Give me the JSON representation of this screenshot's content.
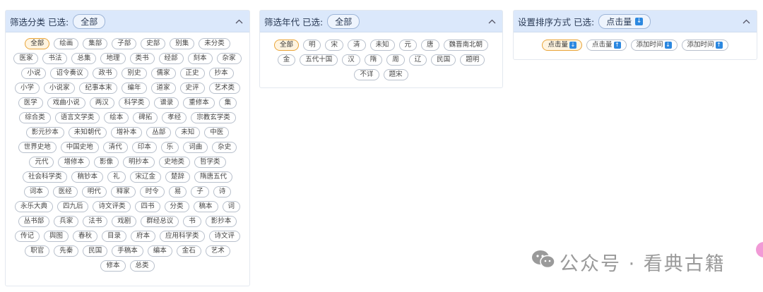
{
  "category_panel": {
    "title": "筛选分类 已选:",
    "selected": "全部",
    "tags": [
      "全部",
      "绘画",
      "集部",
      "子部",
      "史部",
      "别集",
      "未分类",
      "医家",
      "书法",
      "总集",
      "地理",
      "类书",
      "经部",
      "刻本",
      "杂家",
      "小说",
      "诏令奏议",
      "政书",
      "别史",
      "儒家",
      "正史",
      "抄本",
      "小学",
      "小说家",
      "纪事本末",
      "编年",
      "道家",
      "史评",
      "艺术类",
      "医学",
      "戏曲小说",
      "两汉",
      "科学类",
      "谱录",
      "重修本",
      "集",
      "综合类",
      "语言文学类",
      "绘本",
      "碑拓",
      "孝经",
      "宗教玄学类",
      "影元抄本",
      "未知朝代",
      "增补本",
      "丛部",
      "未知",
      "中医",
      "世界史地",
      "中国史地",
      "清代",
      "印本",
      "乐",
      "词曲",
      "杂史",
      "元代",
      "增修本",
      "影像",
      "明抄本",
      "史地类",
      "哲学类",
      "社会科学类",
      "稿钞本",
      "礼",
      "宋辽金",
      "楚辞",
      "隋唐五代",
      "词本",
      "医经",
      "明代",
      "释家",
      "时令",
      "易",
      "子",
      "诗",
      "永乐大典",
      "四九后",
      "诗文评类",
      "四书",
      "分类",
      "稿本",
      "词",
      "丛书部",
      "兵家",
      "法书",
      "戏剧",
      "群经总议",
      "书",
      "影抄本",
      "传记",
      "舆图",
      "春秋",
      "目录",
      "府本",
      "应用科学类",
      "诗文评",
      "职官",
      "先秦",
      "民国",
      "手稿本",
      "编本",
      "金石",
      "艺术",
      "修本",
      "总类"
    ]
  },
  "era_panel": {
    "title": "筛选年代 已选:",
    "selected": "全部",
    "tags": [
      "全部",
      "明",
      "宋",
      "清",
      "未知",
      "元",
      "唐",
      "魏晋南北朝",
      "金",
      "五代十国",
      "汉",
      "隋",
      "周",
      "辽",
      "民国",
      "题明",
      "不详",
      "题宋"
    ]
  },
  "sort_panel": {
    "title": "设置排序方式 已选:",
    "selected": "点击量",
    "selected_arrow": "↓",
    "options": [
      {
        "label": "点击量",
        "arrow": "↓"
      },
      {
        "label": "点击量",
        "arrow": "↑"
      },
      {
        "label": "添加时间",
        "arrow": "↓"
      },
      {
        "label": "添加时间",
        "arrow": "↑"
      }
    ]
  },
  "watermark": {
    "text": "公众号 · 看典古籍",
    "icon": "wechat-icon"
  },
  "colors": {
    "header_bg": "#dbe8fb",
    "active_bg": "#fff4e0",
    "active_border": "#e9a53a",
    "badge": "#2c88e0"
  }
}
